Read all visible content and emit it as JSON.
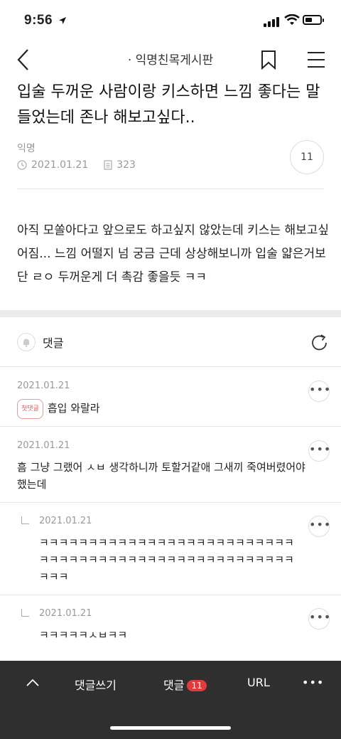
{
  "status": {
    "time": "9:56"
  },
  "nav": {
    "title": "· 익명친목게시판"
  },
  "post": {
    "title": "입술 두꺼운 사람이랑 키스하면 느낌 좋다는 말 들었는데 존나 해보고싶다..",
    "author": "익명",
    "date": "2021.01.21",
    "views": "323",
    "comment_count": "11",
    "body": "아직 모쏠아다고 앞으로도 하고싶지 않았는데 키스는 해보고싶어짐... 느낌 어떨지 넘 궁금 근데 상상해보니까 입술 얇은거보단 ㄹㅇ 두꺼운게 더 촉감 좋을듯 ㅋㅋ"
  },
  "comments_section": {
    "label": "댓글"
  },
  "comments": [
    {
      "date": "2021.01.21",
      "badge": "첫댓글",
      "text": "흡입 와랄라"
    },
    {
      "date": "2021.01.21",
      "text": "흠 그냥 그랬어 ㅅㅂ 생각하니까 토할거같애 그새끼 죽여버렸어야 했는데"
    },
    {
      "date": "2021.01.21",
      "text": "ㅋㅋㅋㅋㅋㅋㅋㅋㅋㅋㅋㅋㅋㅋㅋㅋㅋㅋㅋㅋㅋㅋㅋㅋㅋㅋㅋㅋㅋㅋㅋㅋㅋㅋㅋㅋㅋㅋㅋㅋㅋㅋㅋㅋㅋㅋㅋㅋㅋㅋㅋㅋㅋㅋㅋ"
    },
    {
      "date": "2021.01.21",
      "text": "ㅋㅋㅋㅋㅋㅅㅂㅋㅋ"
    }
  ],
  "bottom_bar": {
    "write_label": "댓글쓰기",
    "comments_label": "댓글",
    "comments_count": "11",
    "url_label": "URL",
    "more_label": "•••"
  },
  "colors": {
    "accent": "#e23b3b",
    "bar": "#2f2f2f"
  }
}
